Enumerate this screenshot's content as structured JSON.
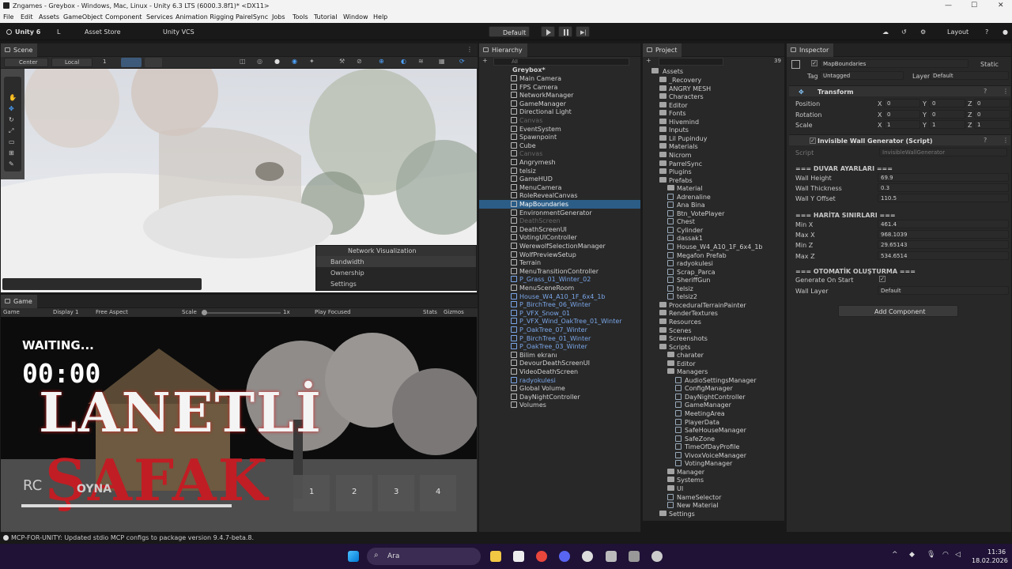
{
  "window": {
    "title": "Zngames - Greybox - Windows, Mac, Linux - Unity 6.3 LTS (6000.3.8f1)* <DX11>"
  },
  "menu": [
    "File",
    "Edit",
    "Assets",
    "GameObject",
    "Component",
    "Services",
    "Animation Rigging",
    "PairelSync",
    "Jobs",
    "Tools",
    "Tutorial",
    "Window",
    "Help"
  ],
  "toolbar": {
    "unity": "Unity 6",
    "account": "L",
    "asset_store": "Asset Store",
    "vcs": "Unity VCS",
    "layout_mode": "Default",
    "layout": "Layout"
  },
  "scene": {
    "tab": "Scene",
    "pivot": "Center",
    "space": "Local",
    "grid_num": "1",
    "network_overlay": {
      "title": "Network Visualization",
      "items": [
        "Bandwidth",
        "Ownership",
        "Settings"
      ]
    }
  },
  "game": {
    "tab": "Game",
    "mode": "Game",
    "display": "Display 1",
    "aspect": "Free Aspect",
    "scale_label": "Scale",
    "scale_value": "1x",
    "play_focused": "Play Focused",
    "stats": "Stats",
    "gizmos": "Gizmos",
    "overlay": {
      "waiting": "WAITING...",
      "timer": "00:00",
      "title1": "LANETLİ",
      "title2": "ŞAFAK",
      "play": "OYNA",
      "rc": "RC",
      "slots": [
        "1",
        "2",
        "3",
        "4"
      ]
    }
  },
  "hierarchy": {
    "tab": "Hierarchy",
    "search_placeholder": "All",
    "root": "Greybox*",
    "items": [
      {
        "label": "Main Camera",
        "kind": "normal"
      },
      {
        "label": "FPS Camera",
        "kind": "normal"
      },
      {
        "label": "NetworkManager",
        "kind": "normal"
      },
      {
        "label": "GameManager",
        "kind": "normal"
      },
      {
        "label": "Directional Light",
        "kind": "normal"
      },
      {
        "label": "Canvas",
        "kind": "dim"
      },
      {
        "label": "EventSystem",
        "kind": "normal"
      },
      {
        "label": "Spawnpoint",
        "kind": "normal"
      },
      {
        "label": "Cube",
        "kind": "normal"
      },
      {
        "label": "Canvas",
        "kind": "dim"
      },
      {
        "label": "Angrymesh",
        "kind": "normal"
      },
      {
        "label": "telsiz",
        "kind": "normal"
      },
      {
        "label": "GameHUD",
        "kind": "normal"
      },
      {
        "label": "MenuCamera",
        "kind": "normal"
      },
      {
        "label": "RoleRevealCanvas",
        "kind": "normal"
      },
      {
        "label": "MapBoundaries",
        "kind": "selected"
      },
      {
        "label": "EnvironmentGenerator",
        "kind": "normal"
      },
      {
        "label": "DeathScreen",
        "kind": "dim"
      },
      {
        "label": "DeathScreenUI",
        "kind": "normal"
      },
      {
        "label": "VotingUIController",
        "kind": "normal"
      },
      {
        "label": "WerewolfSelectionManager",
        "kind": "normal"
      },
      {
        "label": "WolfPreviewSetup",
        "kind": "normal"
      },
      {
        "label": "Terrain",
        "kind": "normal"
      },
      {
        "label": "MenuTransitionController",
        "kind": "normal"
      },
      {
        "label": "P_Grass_01_Winter_02",
        "kind": "prefab"
      },
      {
        "label": "MenuSceneRoom",
        "kind": "normal"
      },
      {
        "label": "House_W4_A10_1F_6x4_1b",
        "kind": "prefab"
      },
      {
        "label": "P_BirchTree_06_Winter",
        "kind": "prefab"
      },
      {
        "label": "P_VFX_Snow_01",
        "kind": "prefab"
      },
      {
        "label": "P_VFX_Wind_OakTree_01_Winter",
        "kind": "prefab"
      },
      {
        "label": "P_OakTree_07_Winter",
        "kind": "prefab"
      },
      {
        "label": "P_BirchTree_01_Winter",
        "kind": "prefab"
      },
      {
        "label": "P_OakTree_03_Winter",
        "kind": "prefab"
      },
      {
        "label": "Bilim ekranı",
        "kind": "normal"
      },
      {
        "label": "DevourDeathScreenUI",
        "kind": "normal"
      },
      {
        "label": "VideoDeathScreen",
        "kind": "normal"
      },
      {
        "label": "radyokulesi",
        "kind": "prefab"
      },
      {
        "label": "Global Volume",
        "kind": "normal"
      },
      {
        "label": "DayNightController",
        "kind": "normal"
      },
      {
        "label": "Volumes",
        "kind": "normal"
      }
    ]
  },
  "project": {
    "tab": "Project",
    "count": "39",
    "root": "Assets",
    "items": [
      {
        "label": "_Recovery",
        "t": "folder",
        "indent": 1
      },
      {
        "label": "ANGRY MESH",
        "t": "folder",
        "indent": 1
      },
      {
        "label": "Characters",
        "t": "folder",
        "indent": 1
      },
      {
        "label": "Editor",
        "t": "folder",
        "indent": 1
      },
      {
        "label": "Fonts",
        "t": "folder",
        "indent": 1
      },
      {
        "label": "Hivemind",
        "t": "folder",
        "indent": 1
      },
      {
        "label": "Inputs",
        "t": "folder",
        "indent": 1
      },
      {
        "label": "Lil Pupinduy",
        "t": "folder",
        "indent": 1
      },
      {
        "label": "Materials",
        "t": "folder",
        "indent": 1
      },
      {
        "label": "Nicrom",
        "t": "folder",
        "indent": 1
      },
      {
        "label": "ParrelSync",
        "t": "folder",
        "indent": 1
      },
      {
        "label": "Plugins",
        "t": "folder",
        "indent": 1
      },
      {
        "label": "Prefabs",
        "t": "folder",
        "indent": 1
      },
      {
        "label": "Material",
        "t": "folder",
        "indent": 2
      },
      {
        "label": "Adrenaline",
        "t": "asset",
        "indent": 2
      },
      {
        "label": "Ana Bina",
        "t": "asset",
        "indent": 2
      },
      {
        "label": "Btn_VotePlayer",
        "t": "asset",
        "indent": 2
      },
      {
        "label": "Chest",
        "t": "asset",
        "indent": 2
      },
      {
        "label": "Cylinder",
        "t": "asset",
        "indent": 2
      },
      {
        "label": "dassak1",
        "t": "asset",
        "indent": 2
      },
      {
        "label": "House_W4_A10_1F_6x4_1b",
        "t": "asset",
        "indent": 2
      },
      {
        "label": "Megafon Prefab",
        "t": "asset",
        "indent": 2
      },
      {
        "label": "radyokulesi",
        "t": "asset",
        "indent": 2
      },
      {
        "label": "Scrap_Parca",
        "t": "asset",
        "indent": 2
      },
      {
        "label": "SheriffGun",
        "t": "asset",
        "indent": 2
      },
      {
        "label": "telsiz",
        "t": "asset",
        "indent": 2
      },
      {
        "label": "telsiz2",
        "t": "asset",
        "indent": 2
      },
      {
        "label": "ProceduralTerrainPainter",
        "t": "folder",
        "indent": 1
      },
      {
        "label": "RenderTextures",
        "t": "folder",
        "indent": 1
      },
      {
        "label": "Resources",
        "t": "folder",
        "indent": 1
      },
      {
        "label": "Scenes",
        "t": "folder",
        "indent": 1
      },
      {
        "label": "Screenshots",
        "t": "folder",
        "indent": 1
      },
      {
        "label": "Scripts",
        "t": "folder",
        "indent": 1
      },
      {
        "label": "charater",
        "t": "folder",
        "indent": 2
      },
      {
        "label": "Editor",
        "t": "folder",
        "indent": 2
      },
      {
        "label": "Managers",
        "t": "folder",
        "indent": 2
      },
      {
        "label": "AudioSettingsManager",
        "t": "asset",
        "indent": 3
      },
      {
        "label": "ConfigManager",
        "t": "asset",
        "indent": 3
      },
      {
        "label": "DayNightController",
        "t": "asset",
        "indent": 3
      },
      {
        "label": "GameManager",
        "t": "asset",
        "indent": 3
      },
      {
        "label": "MeetingArea",
        "t": "asset",
        "indent": 3
      },
      {
        "label": "PlayerData",
        "t": "asset",
        "indent": 3
      },
      {
        "label": "SafeHouseManager",
        "t": "asset",
        "indent": 3
      },
      {
        "label": "SafeZone",
        "t": "asset",
        "indent": 3
      },
      {
        "label": "TimeOfDayProfile",
        "t": "asset",
        "indent": 3
      },
      {
        "label": "VivoxVoiceManager",
        "t": "asset",
        "indent": 3
      },
      {
        "label": "VotingManager",
        "t": "asset",
        "indent": 3
      },
      {
        "label": "Manager",
        "t": "folder",
        "indent": 2
      },
      {
        "label": "Systems",
        "t": "folder",
        "indent": 2
      },
      {
        "label": "UI",
        "t": "folder",
        "indent": 2
      },
      {
        "label": "NameSelector",
        "t": "asset",
        "indent": 2
      },
      {
        "label": "New Material",
        "t": "asset",
        "indent": 2
      },
      {
        "label": "Settings",
        "t": "folder",
        "indent": 1
      }
    ]
  },
  "inspector": {
    "tab": "Inspector",
    "object_name": "MapBoundaries",
    "static_label": "Static",
    "tag_label": "Tag",
    "tag_value": "Untagged",
    "layer_label": "Layer",
    "layer_value": "Default",
    "transform": {
      "title": "Transform",
      "position": "Position",
      "rotation": "Rotation",
      "scale": "Scale",
      "pos": [
        "0",
        "0",
        "0"
      ],
      "rot": [
        "0",
        "0",
        "0"
      ],
      "scl": [
        "1",
        "1",
        "1"
      ],
      "x": "X",
      "y": "Y",
      "z": "Z"
    },
    "script": {
      "title": "Invisible Wall Generator (Script)",
      "script_label": "Script",
      "script_value": "InvisibleWallGenerator",
      "sec1": "=== DUVAR AYARLARI ===",
      "wall_height_label": "Wall Height",
      "wall_height": "69.9",
      "wall_thickness_label": "Wall Thickness",
      "wall_thickness": "0.3",
      "wall_offset_label": "Wall Y Offset",
      "wall_offset": "110.5",
      "sec2": "=== HARİTA SINIRLARI ===",
      "min_x_label": "Min X",
      "min_x": "461.4",
      "max_x_label": "Max X",
      "max_x": "968.1039",
      "min_z_label": "Min Z",
      "min_z": "29.65143",
      "max_z_label": "Max Z",
      "max_z": "534.6514",
      "sec3": "=== OTOMATİK OLUŞTURMA ===",
      "gen_label": "Generate On Start",
      "wall_layer_label": "Wall Layer",
      "wall_layer": "Default"
    },
    "add_component": "Add Component"
  },
  "status": {
    "message": "MCP-FOR-UNITY: Updated stdio MCP configs to package version 9.4.7-beta.8."
  },
  "taskbar": {
    "search": "Ara",
    "time": "11:36",
    "date": "18.02.2026"
  }
}
